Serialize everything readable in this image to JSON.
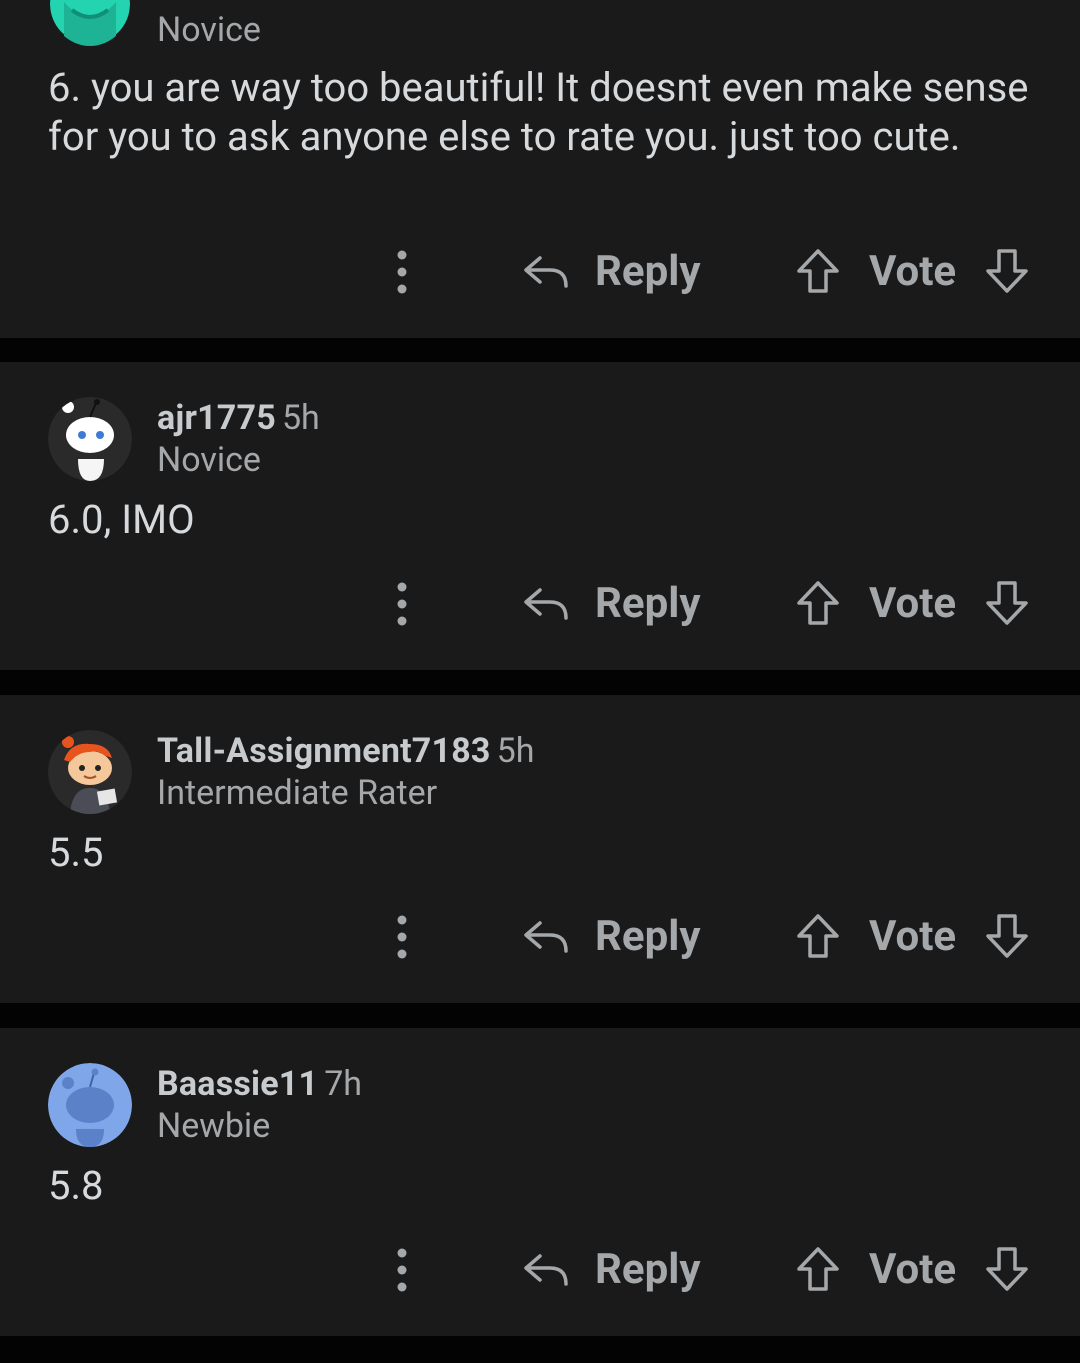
{
  "actions": {
    "reply_label": "Reply",
    "vote_label": "Vote",
    "more_icon": "kebab-vertical-icon",
    "reply_icon": "reply-arrow-icon",
    "upvote_icon": "upvote-arrow-icon",
    "downvote_icon": "downvote-arrow-icon"
  },
  "colors": {
    "page_bg": "#030303",
    "card_bg": "#1a1a1b",
    "text_primary": "#d7dadc",
    "text_secondary": "#a5a8aa"
  },
  "comments": [
    {
      "flair": "Novice",
      "body": "6. you are way too beautiful! It doesnt even make sense for you to ask anyone else to rate you. just too cute.",
      "avatar_color": "#24d3b0"
    },
    {
      "username": "ajr1775",
      "age": "5h",
      "flair": "Novice",
      "body": "6.0, IMO",
      "avatar_color": "#2a2a2b"
    },
    {
      "username": "Tall-Assignment7183",
      "age": "5h",
      "flair": "Intermediate Rater",
      "body": "5.5",
      "avatar_color": "#2a2a2b"
    },
    {
      "username": "Baassie11",
      "age": "7h",
      "flair": "Newbie",
      "body": "5.8",
      "avatar_color": "#7fa6e8"
    }
  ]
}
